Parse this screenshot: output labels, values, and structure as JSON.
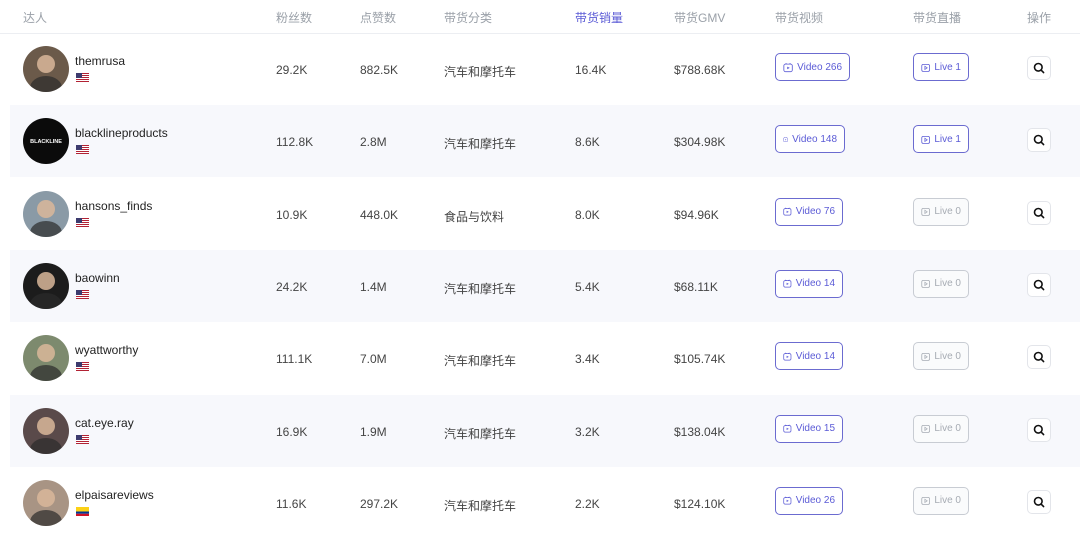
{
  "columns": {
    "influencer": "达人",
    "followers": "粉丝数",
    "likes": "点赞数",
    "category": "带货分类",
    "sales": "带货销量",
    "gmv": "带货GMV",
    "videos": "带货视频",
    "lives": "带货直播",
    "actions": "操作"
  },
  "active_sort_column": "带货销量",
  "colors": {
    "accent": "#5b5bd6",
    "row_shade": "#f7f8fc",
    "disabled": "#a6abb3"
  },
  "rows": [
    {
      "name": "themrusa",
      "flag": "us-flag-icon",
      "followers": "29.2K",
      "likes": "882.5K",
      "category": "汽车和摩托车",
      "sales": "16.4K",
      "gmv": "$788.68K",
      "video": "Video 266",
      "live": "Live 1",
      "live_active": true
    },
    {
      "name": "blacklineproducts",
      "flag": "us-flag-icon",
      "followers": "112.8K",
      "likes": "2.8M",
      "category": "汽车和摩托车",
      "sales": "8.6K",
      "gmv": "$304.98K",
      "video": "Video 148",
      "live": "Live 1",
      "live_active": true,
      "avatar_text": "BLACKLINE"
    },
    {
      "name": "hansons_finds",
      "flag": "us-flag-icon",
      "followers": "10.9K",
      "likes": "448.0K",
      "category": "食品与饮料",
      "sales": "8.0K",
      "gmv": "$94.96K",
      "video": "Video 76",
      "live": "Live 0",
      "live_active": false
    },
    {
      "name": "baowinn",
      "flag": "us-flag-icon",
      "followers": "24.2K",
      "likes": "1.4M",
      "category": "汽车和摩托车",
      "sales": "5.4K",
      "gmv": "$68.11K",
      "video": "Video 14",
      "live": "Live 0",
      "live_active": false
    },
    {
      "name": "wyattworthy",
      "flag": "us-flag-icon",
      "followers": "111.1K",
      "likes": "7.0M",
      "category": "汽车和摩托车",
      "sales": "3.4K",
      "gmv": "$105.74K",
      "video": "Video 14",
      "live": "Live 0",
      "live_active": false
    },
    {
      "name": "cat.eye.ray",
      "flag": "us-flag-icon",
      "followers": "16.9K",
      "likes": "1.9M",
      "category": "汽车和摩托车",
      "sales": "3.2K",
      "gmv": "$138.04K",
      "video": "Video 15",
      "live": "Live 0",
      "live_active": false
    },
    {
      "name": "elpaisareviews",
      "flag": "co-flag-icon",
      "followers": "11.6K",
      "likes": "297.2K",
      "category": "汽车和摩托车",
      "sales": "2.2K",
      "gmv": "$124.10K",
      "video": "Video 26",
      "live": "Live 0",
      "live_active": false
    }
  ]
}
